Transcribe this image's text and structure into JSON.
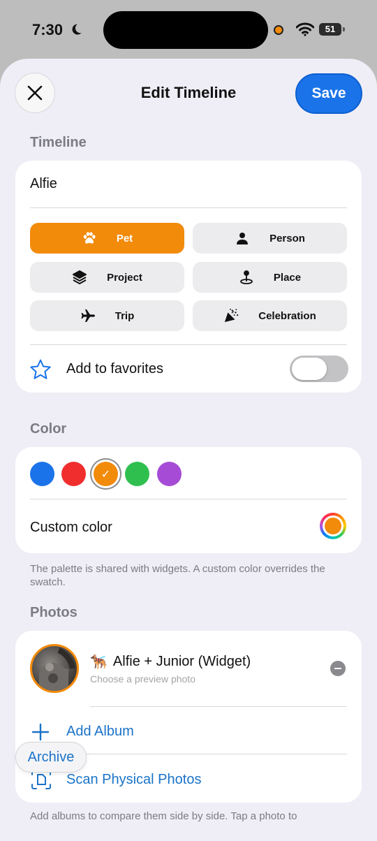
{
  "status_bar": {
    "time": "7:30",
    "battery": "51"
  },
  "nav": {
    "title": "Edit Timeline",
    "save_label": "Save"
  },
  "timeline": {
    "section_label": "Timeline",
    "name": "Alfie",
    "types": [
      {
        "label": "Pet",
        "icon": "paw-icon",
        "selected": true
      },
      {
        "label": "Person",
        "icon": "person-icon",
        "selected": false
      },
      {
        "label": "Project",
        "icon": "layers-icon",
        "selected": false
      },
      {
        "label": "Place",
        "icon": "map-pin-icon",
        "selected": false
      },
      {
        "label": "Trip",
        "icon": "airplane-icon",
        "selected": false
      },
      {
        "label": "Celebration",
        "icon": "party-popper-icon",
        "selected": false
      }
    ],
    "favorites_label": "Add to favorites",
    "favorites_on": false
  },
  "color": {
    "section_label": "Color",
    "swatches": [
      "#1a73e8",
      "#f02e2e",
      "#f28a0a",
      "#2fbf4f",
      "#a64bd6"
    ],
    "selected_swatch": "#f28a0a",
    "custom_label": "Custom color",
    "custom_value": "#f28a0a",
    "footnote": "The palette is shared with widgets. A custom color overrides the swatch."
  },
  "photos": {
    "section_label": "Photos",
    "album": {
      "emoji": "🐕‍🦺",
      "title": "Alfie + Junior (Widget)",
      "subtitle": "Choose a preview photo"
    },
    "add_album_label": "Add Album",
    "scan_label": "Scan Physical Photos",
    "footnote": "Add albums to compare them side by side. Tap a photo to"
  },
  "archive_label": "Archive",
  "colors": {
    "accent": "#f28a0a",
    "primary": "#1a73e8",
    "link": "#1a73c8"
  }
}
